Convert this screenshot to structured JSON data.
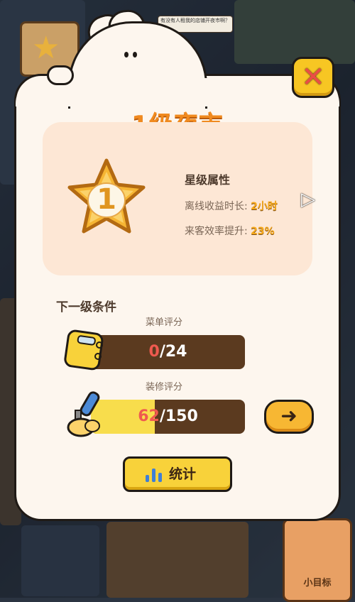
{
  "top_sign": {
    "text": "有没有人租我的店铺开夜市啊？"
  },
  "corner_badge": {
    "level": "1"
  },
  "panel": {
    "title": "1级夜市",
    "close_icon": "close-x-icon",
    "star_level": "1",
    "attributes": {
      "heading": "星级属性",
      "rows": [
        {
          "label": "离线收益时长:",
          "value": "2小时"
        },
        {
          "label": "来客效率提升:",
          "value": "23%"
        }
      ]
    },
    "next_level": {
      "heading": "下一级条件",
      "requirements": [
        {
          "label": "菜单评分",
          "current": "0",
          "sep": "/",
          "target": "24",
          "progress": 0.0
        },
        {
          "label": "装修评分",
          "current": "62",
          "sep": "/",
          "target": "150",
          "progress": 0.4133
        }
      ]
    },
    "stats_button": {
      "label": "统计"
    }
  },
  "bottom_card": {
    "label": "小目标"
  },
  "colors": {
    "accent_orange": "#f08a1f",
    "button_yellow": "#f8d23a",
    "bar_brown": "#5b3a1f",
    "bar_fill": "#f8dd4c",
    "close_red": "#ea4d45"
  }
}
